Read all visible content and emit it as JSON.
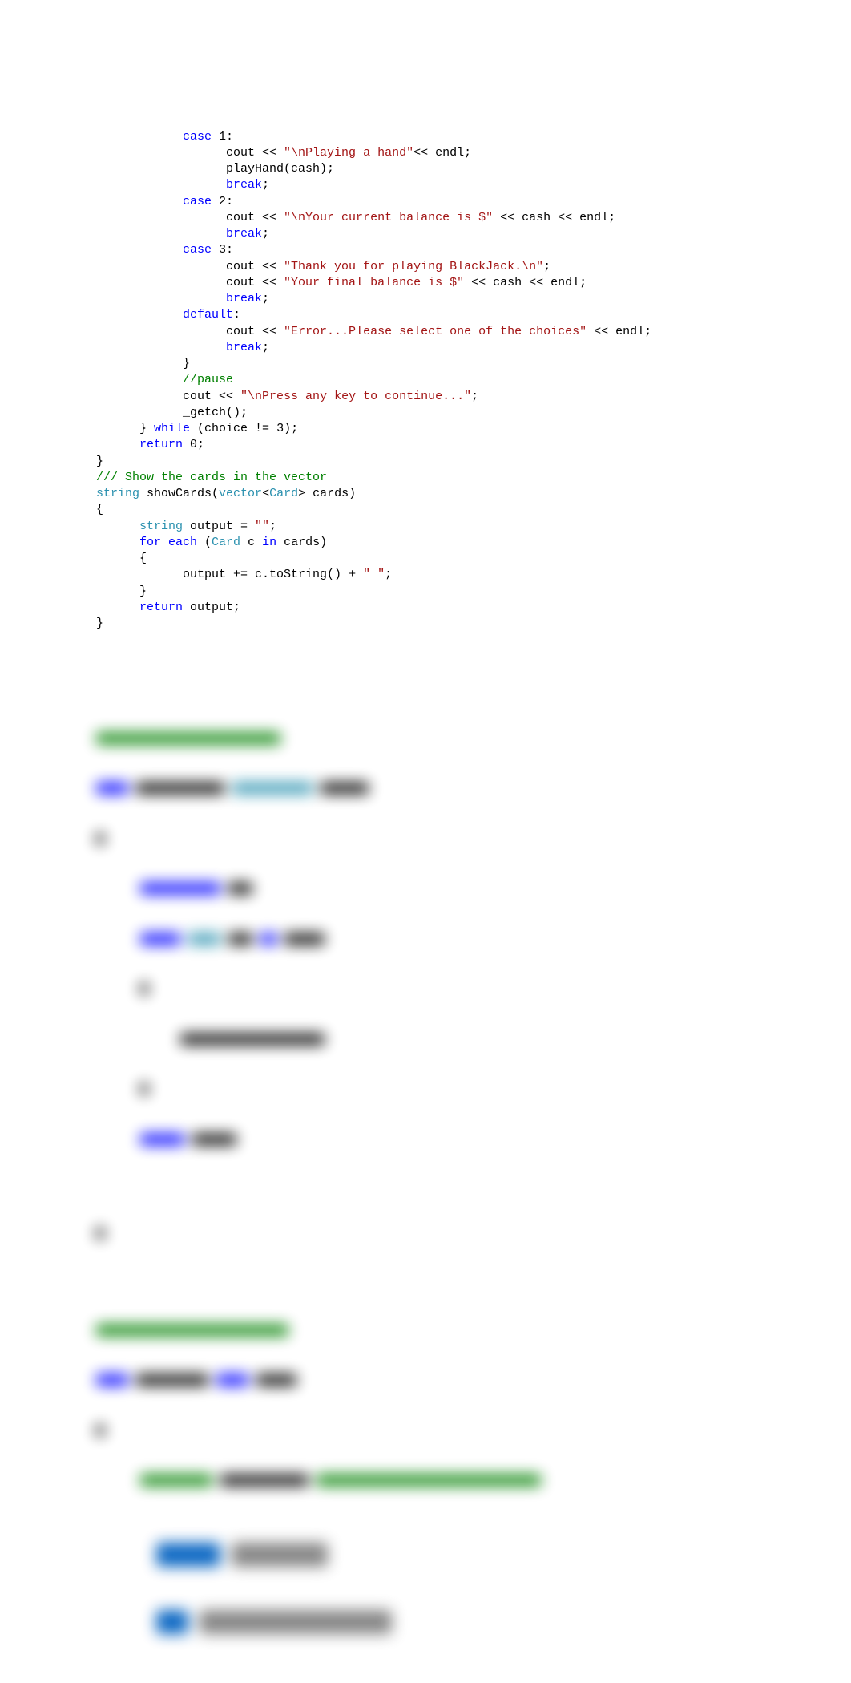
{
  "code": {
    "lines": [
      {
        "indent": 12,
        "parts": [
          {
            "cls": "k",
            "t": "case"
          },
          {
            "cls": "n",
            "t": " 1:"
          }
        ]
      },
      {
        "indent": 18,
        "parts": [
          {
            "cls": "n",
            "t": "cout << "
          },
          {
            "cls": "s",
            "t": "\"\\nPlaying a hand\""
          },
          {
            "cls": "n",
            "t": "<< endl;"
          }
        ]
      },
      {
        "indent": 18,
        "parts": [
          {
            "cls": "n",
            "t": "playHand(cash);"
          }
        ]
      },
      {
        "indent": 18,
        "parts": [
          {
            "cls": "k",
            "t": "break"
          },
          {
            "cls": "n",
            "t": ";"
          }
        ]
      },
      {
        "indent": 12,
        "parts": [
          {
            "cls": "k",
            "t": "case"
          },
          {
            "cls": "n",
            "t": " 2:"
          }
        ]
      },
      {
        "indent": 18,
        "parts": [
          {
            "cls": "n",
            "t": "cout << "
          },
          {
            "cls": "s",
            "t": "\"\\nYour current balance is $\""
          },
          {
            "cls": "n",
            "t": " << cash << endl;"
          }
        ]
      },
      {
        "indent": 18,
        "parts": [
          {
            "cls": "k",
            "t": "break"
          },
          {
            "cls": "n",
            "t": ";"
          }
        ]
      },
      {
        "indent": 12,
        "parts": [
          {
            "cls": "k",
            "t": "case"
          },
          {
            "cls": "n",
            "t": " 3:"
          }
        ]
      },
      {
        "indent": 18,
        "parts": [
          {
            "cls": "n",
            "t": "cout << "
          },
          {
            "cls": "s",
            "t": "\"Thank you for playing BlackJack.\\n\""
          },
          {
            "cls": "n",
            "t": ";"
          }
        ]
      },
      {
        "indent": 18,
        "parts": [
          {
            "cls": "n",
            "t": "cout << "
          },
          {
            "cls": "s",
            "t": "\"Your final balance is $\""
          },
          {
            "cls": "n",
            "t": " << cash << endl;"
          }
        ]
      },
      {
        "indent": 18,
        "parts": [
          {
            "cls": "k",
            "t": "break"
          },
          {
            "cls": "n",
            "t": ";"
          }
        ]
      },
      {
        "indent": 0,
        "parts": [
          {
            "cls": "n",
            "t": ""
          }
        ]
      },
      {
        "indent": 12,
        "parts": [
          {
            "cls": "k",
            "t": "default"
          },
          {
            "cls": "n",
            "t": ":"
          }
        ]
      },
      {
        "indent": 18,
        "parts": [
          {
            "cls": "n",
            "t": "cout << "
          },
          {
            "cls": "s",
            "t": "\"Error...Please select one of the choices\""
          },
          {
            "cls": "n",
            "t": " << endl;"
          }
        ]
      },
      {
        "indent": 18,
        "parts": [
          {
            "cls": "k",
            "t": "break"
          },
          {
            "cls": "n",
            "t": ";"
          }
        ]
      },
      {
        "indent": 12,
        "parts": [
          {
            "cls": "n",
            "t": "}"
          }
        ]
      },
      {
        "indent": 12,
        "parts": [
          {
            "cls": "c",
            "t": "//pause"
          }
        ]
      },
      {
        "indent": 12,
        "parts": [
          {
            "cls": "n",
            "t": "cout << "
          },
          {
            "cls": "s",
            "t": "\"\\nPress any key to continue...\""
          },
          {
            "cls": "n",
            "t": ";"
          }
        ]
      },
      {
        "indent": 12,
        "parts": [
          {
            "cls": "n",
            "t": "_getch();"
          }
        ]
      },
      {
        "indent": 0,
        "parts": [
          {
            "cls": "n",
            "t": ""
          }
        ]
      },
      {
        "indent": 6,
        "parts": [
          {
            "cls": "n",
            "t": "} "
          },
          {
            "cls": "k",
            "t": "while"
          },
          {
            "cls": "n",
            "t": " (choice != 3);"
          }
        ]
      },
      {
        "indent": 0,
        "parts": [
          {
            "cls": "n",
            "t": ""
          }
        ]
      },
      {
        "indent": 6,
        "parts": [
          {
            "cls": "k",
            "t": "return"
          },
          {
            "cls": "n",
            "t": " 0;"
          }
        ]
      },
      {
        "indent": 0,
        "parts": [
          {
            "cls": "n",
            "t": "}"
          }
        ]
      },
      {
        "indent": 0,
        "parts": [
          {
            "cls": "n",
            "t": ""
          }
        ]
      },
      {
        "indent": 0,
        "parts": [
          {
            "cls": "c",
            "t": "/// Show the cards in the vector"
          }
        ]
      },
      {
        "indent": 0,
        "parts": [
          {
            "cls": "t",
            "t": "string"
          },
          {
            "cls": "n",
            "t": " showCards("
          },
          {
            "cls": "t",
            "t": "vector"
          },
          {
            "cls": "n",
            "t": "<"
          },
          {
            "cls": "t",
            "t": "Card"
          },
          {
            "cls": "n",
            "t": "> cards)"
          }
        ]
      },
      {
        "indent": 0,
        "parts": [
          {
            "cls": "n",
            "t": "{"
          }
        ]
      },
      {
        "indent": 6,
        "parts": [
          {
            "cls": "t",
            "t": "string"
          },
          {
            "cls": "n",
            "t": " output = "
          },
          {
            "cls": "s",
            "t": "\"\""
          },
          {
            "cls": "n",
            "t": ";"
          }
        ]
      },
      {
        "indent": 6,
        "parts": [
          {
            "cls": "k",
            "t": "for each"
          },
          {
            "cls": "n",
            "t": " ("
          },
          {
            "cls": "t",
            "t": "Card"
          },
          {
            "cls": "n",
            "t": " c "
          },
          {
            "cls": "k",
            "t": "in"
          },
          {
            "cls": "n",
            "t": " cards)"
          }
        ]
      },
      {
        "indent": 6,
        "parts": [
          {
            "cls": "n",
            "t": "{"
          }
        ]
      },
      {
        "indent": 12,
        "parts": [
          {
            "cls": "n",
            "t": "output += c.toString() + "
          },
          {
            "cls": "s",
            "t": "\" \""
          },
          {
            "cls": "n",
            "t": ";"
          }
        ]
      },
      {
        "indent": 6,
        "parts": [
          {
            "cls": "n",
            "t": "}"
          }
        ]
      },
      {
        "indent": 0,
        "parts": [
          {
            "cls": "n",
            "t": ""
          }
        ]
      },
      {
        "indent": 6,
        "parts": [
          {
            "cls": "k",
            "t": "return"
          },
          {
            "cls": "n",
            "t": " output;"
          }
        ]
      },
      {
        "indent": 0,
        "parts": [
          {
            "cls": "n",
            "t": "}"
          }
        ]
      }
    ]
  }
}
